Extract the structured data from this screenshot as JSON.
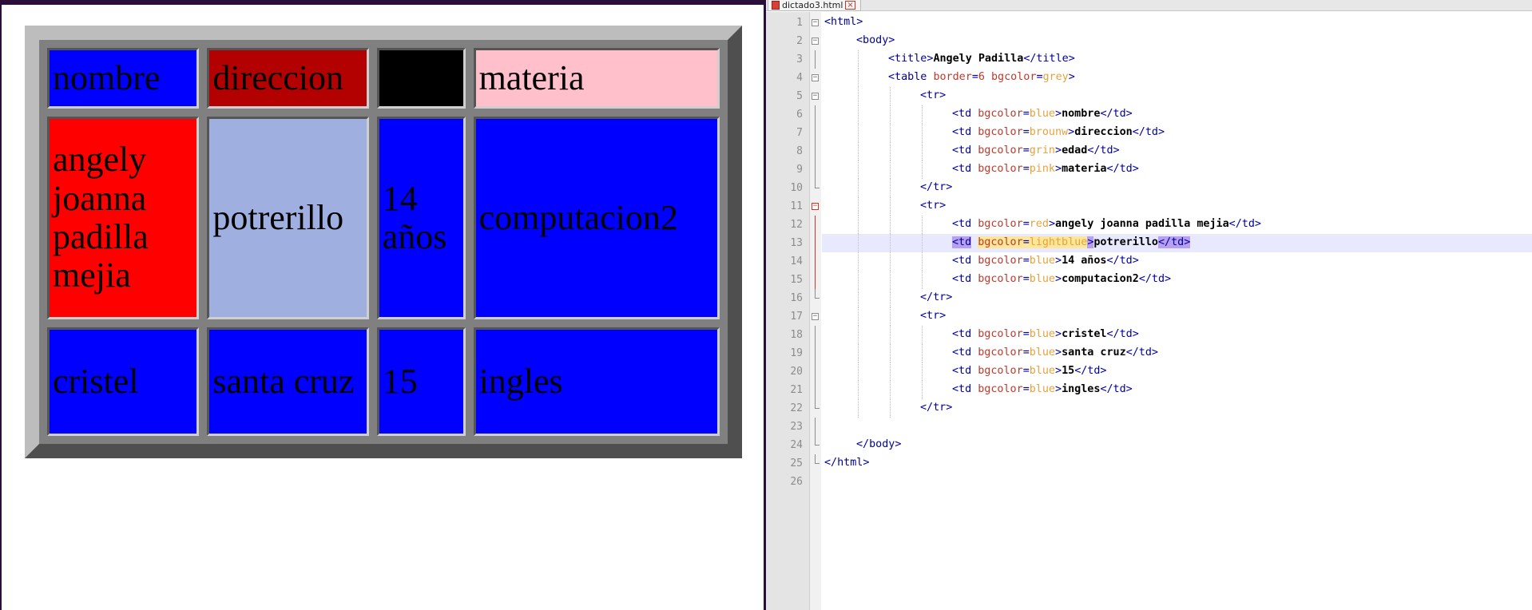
{
  "browser": {
    "table": {
      "rows": [
        [
          {
            "text": "nombre",
            "bg": "#0000ff"
          },
          {
            "text": "direccion",
            "bg": "#b30000"
          },
          {
            "text": "",
            "bg": "#000000"
          },
          {
            "text": "materia",
            "bg": "#ffc0cb"
          }
        ],
        [
          {
            "text": "angely joanna padilla mejia",
            "bg": "#ff0000"
          },
          {
            "text": "potrerillo",
            "bg": "#9fb0e0"
          },
          {
            "text": "14 años",
            "bg": "#0000ff"
          },
          {
            "text": "computacion2",
            "bg": "#0000ff"
          }
        ],
        [
          {
            "text": "cristel",
            "bg": "#0000ff"
          },
          {
            "text": "santa cruz",
            "bg": "#0000ff"
          },
          {
            "text": "15",
            "bg": "#0000ff"
          },
          {
            "text": "ingles",
            "bg": "#0000ff"
          }
        ]
      ]
    }
  },
  "editor": {
    "tab": {
      "label": "dictado3.html",
      "icon": "html-file-icon",
      "close_icon": "close-icon"
    },
    "highlighted_line": 13,
    "lines": [
      {
        "n": "1",
        "indent": 0,
        "fold": "minus",
        "tokens": [
          {
            "t": "tag",
            "v": "<html>"
          }
        ]
      },
      {
        "n": "2",
        "indent": 1,
        "fold": "minus",
        "tokens": [
          {
            "t": "tag",
            "v": "<body>"
          }
        ]
      },
      {
        "n": "3",
        "indent": 2,
        "fold": "bar",
        "tokens": [
          {
            "t": "tag",
            "v": "<title>"
          },
          {
            "t": "text",
            "v": "Angely Padilla"
          },
          {
            "t": "tag",
            "v": "</title>"
          }
        ]
      },
      {
        "n": "4",
        "indent": 2,
        "fold": "minus",
        "tokens": [
          {
            "t": "tag",
            "v": "<table "
          },
          {
            "t": "attr",
            "v": "border"
          },
          {
            "t": "tag",
            "v": "="
          },
          {
            "t": "attr",
            "v": "6 "
          },
          {
            "t": "attr",
            "v": "bgcolor"
          },
          {
            "t": "tag",
            "v": "="
          },
          {
            "t": "val",
            "v": "grey"
          },
          {
            "t": "tag",
            "v": ">"
          }
        ]
      },
      {
        "n": "5",
        "indent": 3,
        "fold": "minus",
        "tokens": [
          {
            "t": "tag",
            "v": "<tr>"
          }
        ]
      },
      {
        "n": "6",
        "indent": 4,
        "fold": "bar",
        "tokens": [
          {
            "t": "tag",
            "v": "<td "
          },
          {
            "t": "attr",
            "v": "bgcolor"
          },
          {
            "t": "tag",
            "v": "="
          },
          {
            "t": "val",
            "v": "blue"
          },
          {
            "t": "tag",
            "v": ">"
          },
          {
            "t": "text",
            "v": "nombre"
          },
          {
            "t": "tag",
            "v": "</td>"
          }
        ]
      },
      {
        "n": "7",
        "indent": 4,
        "fold": "bar",
        "tokens": [
          {
            "t": "tag",
            "v": "<td "
          },
          {
            "t": "attr",
            "v": "bgcolor"
          },
          {
            "t": "tag",
            "v": "="
          },
          {
            "t": "val",
            "v": "brounw"
          },
          {
            "t": "tag",
            "v": ">"
          },
          {
            "t": "text",
            "v": "direccion"
          },
          {
            "t": "tag",
            "v": "</td>"
          }
        ]
      },
      {
        "n": "8",
        "indent": 4,
        "fold": "bar",
        "tokens": [
          {
            "t": "tag",
            "v": "<td "
          },
          {
            "t": "attr",
            "v": "bgcolor"
          },
          {
            "t": "tag",
            "v": "="
          },
          {
            "t": "val",
            "v": "grin"
          },
          {
            "t": "tag",
            "v": ">"
          },
          {
            "t": "text",
            "v": "edad"
          },
          {
            "t": "tag",
            "v": "</td>"
          }
        ]
      },
      {
        "n": "9",
        "indent": 4,
        "fold": "bar",
        "tokens": [
          {
            "t": "tag",
            "v": "<td "
          },
          {
            "t": "attr",
            "v": "bgcolor"
          },
          {
            "t": "tag",
            "v": "="
          },
          {
            "t": "val",
            "v": "pink"
          },
          {
            "t": "tag",
            "v": ">"
          },
          {
            "t": "text",
            "v": "materia"
          },
          {
            "t": "tag",
            "v": "</td>"
          }
        ]
      },
      {
        "n": "10",
        "indent": 3,
        "fold": "end",
        "tokens": [
          {
            "t": "tag",
            "v": "</tr>"
          }
        ]
      },
      {
        "n": "11",
        "indent": 3,
        "fold": "minus-red",
        "tokens": [
          {
            "t": "tag",
            "v": "<tr>"
          }
        ]
      },
      {
        "n": "12",
        "indent": 4,
        "fold": "bar-red",
        "tokens": [
          {
            "t": "tag",
            "v": "<td "
          },
          {
            "t": "attr",
            "v": "bgcolor"
          },
          {
            "t": "tag",
            "v": "="
          },
          {
            "t": "val",
            "v": "red"
          },
          {
            "t": "tag",
            "v": ">"
          },
          {
            "t": "text",
            "v": "angely joanna padilla mejia"
          },
          {
            "t": "tag",
            "v": "</td>"
          }
        ]
      },
      {
        "n": "13",
        "indent": 4,
        "fold": "bar-red",
        "tokens": [
          {
            "t": "match",
            "v": "<td"
          },
          {
            "t": "tag",
            "v": " "
          },
          {
            "t": "wattr",
            "v": "bgcolor"
          },
          {
            "t": "wtag",
            "v": "="
          },
          {
            "t": "wval",
            "v": "lightblue"
          },
          {
            "t": "match",
            "v": ">"
          },
          {
            "t": "text",
            "v": "potrerillo"
          },
          {
            "t": "match",
            "v": "</td>"
          }
        ]
      },
      {
        "n": "14",
        "indent": 4,
        "fold": "bar-red",
        "tokens": [
          {
            "t": "tag",
            "v": "<td "
          },
          {
            "t": "attr",
            "v": "bgcolor"
          },
          {
            "t": "tag",
            "v": "="
          },
          {
            "t": "val",
            "v": "blue"
          },
          {
            "t": "tag",
            "v": ">"
          },
          {
            "t": "text",
            "v": "14 años"
          },
          {
            "t": "tag",
            "v": "</td>"
          }
        ]
      },
      {
        "n": "15",
        "indent": 4,
        "fold": "bar-red",
        "tokens": [
          {
            "t": "tag",
            "v": "<td "
          },
          {
            "t": "attr",
            "v": "bgcolor"
          },
          {
            "t": "tag",
            "v": "="
          },
          {
            "t": "val",
            "v": "blue"
          },
          {
            "t": "tag",
            "v": ">"
          },
          {
            "t": "text",
            "v": "computacion2"
          },
          {
            "t": "tag",
            "v": "</td>"
          }
        ]
      },
      {
        "n": "16",
        "indent": 3,
        "fold": "end",
        "tokens": [
          {
            "t": "tag",
            "v": "</tr>"
          }
        ]
      },
      {
        "n": "17",
        "indent": 3,
        "fold": "minus",
        "tokens": [
          {
            "t": "tag",
            "v": "<tr>"
          }
        ]
      },
      {
        "n": "18",
        "indent": 4,
        "fold": "bar",
        "tokens": [
          {
            "t": "tag",
            "v": "<td "
          },
          {
            "t": "attr",
            "v": "bgcolor"
          },
          {
            "t": "tag",
            "v": "="
          },
          {
            "t": "val",
            "v": "blue"
          },
          {
            "t": "tag",
            "v": ">"
          },
          {
            "t": "text",
            "v": "cristel"
          },
          {
            "t": "tag",
            "v": "</td>"
          }
        ]
      },
      {
        "n": "19",
        "indent": 4,
        "fold": "bar",
        "tokens": [
          {
            "t": "tag",
            "v": "<td "
          },
          {
            "t": "attr",
            "v": "bgcolor"
          },
          {
            "t": "tag",
            "v": "="
          },
          {
            "t": "val",
            "v": "blue"
          },
          {
            "t": "tag",
            "v": ">"
          },
          {
            "t": "text",
            "v": "santa cruz"
          },
          {
            "t": "tag",
            "v": "</td>"
          }
        ]
      },
      {
        "n": "20",
        "indent": 4,
        "fold": "bar",
        "tokens": [
          {
            "t": "tag",
            "v": "<td "
          },
          {
            "t": "attr",
            "v": "bgcolor"
          },
          {
            "t": "tag",
            "v": "="
          },
          {
            "t": "val",
            "v": "blue"
          },
          {
            "t": "tag",
            "v": ">"
          },
          {
            "t": "text",
            "v": "15"
          },
          {
            "t": "tag",
            "v": "</td>"
          }
        ]
      },
      {
        "n": "21",
        "indent": 4,
        "fold": "bar",
        "tokens": [
          {
            "t": "tag",
            "v": "<td "
          },
          {
            "t": "attr",
            "v": "bgcolor"
          },
          {
            "t": "tag",
            "v": "="
          },
          {
            "t": "val",
            "v": "blue"
          },
          {
            "t": "tag",
            "v": ">"
          },
          {
            "t": "text",
            "v": "ingles"
          },
          {
            "t": "tag",
            "v": "</td>"
          }
        ]
      },
      {
        "n": "22",
        "indent": 3,
        "fold": "end",
        "tokens": [
          {
            "t": "tag",
            "v": "</tr>"
          }
        ]
      },
      {
        "n": "23",
        "indent": 0,
        "fold": "bar",
        "tokens": []
      },
      {
        "n": "24",
        "indent": 1,
        "fold": "end",
        "tokens": [
          {
            "t": "tag",
            "v": "</body>"
          }
        ]
      },
      {
        "n": "25",
        "indent": 0,
        "fold": "end",
        "tokens": [
          {
            "t": "tag",
            "v": "</html>"
          }
        ]
      },
      {
        "n": "26",
        "indent": 0,
        "fold": "none",
        "tokens": []
      }
    ]
  }
}
